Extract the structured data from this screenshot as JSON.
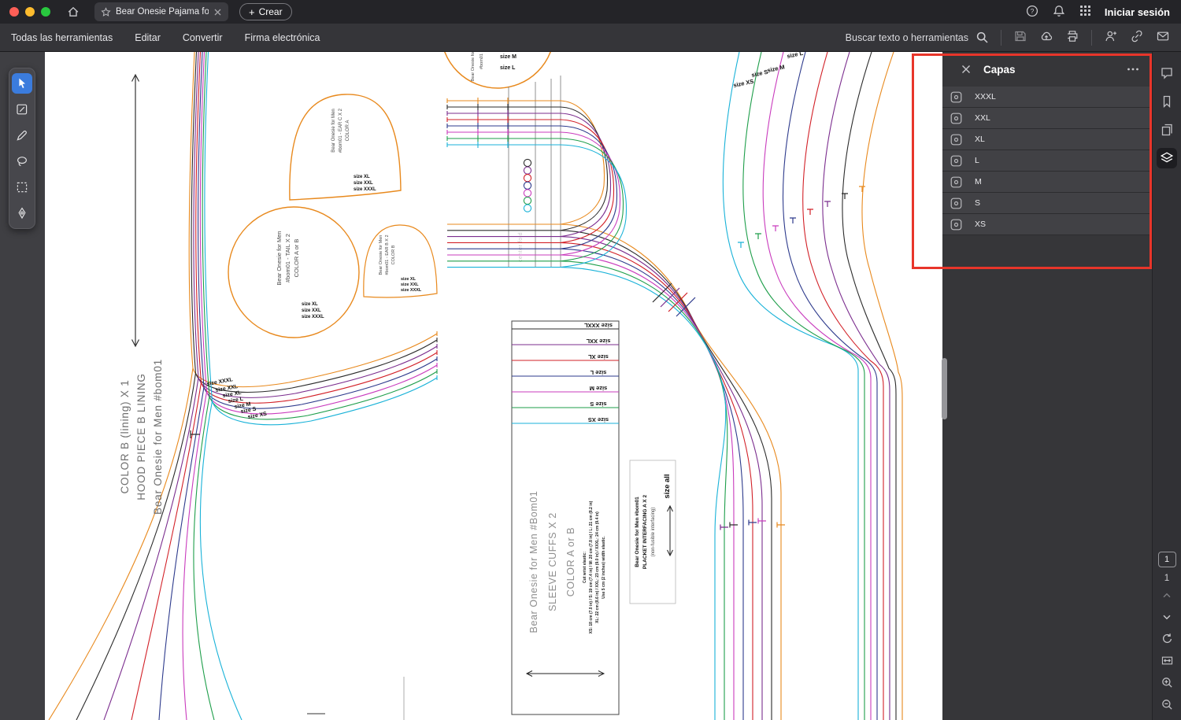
{
  "window": {
    "tab_title": "Bear Onesie Pajama fo...",
    "create_label": "Crear",
    "sign_in_label": "Iniciar sesión"
  },
  "menubar": {
    "items": [
      "Todas las herramientas",
      "Editar",
      "Convertir",
      "Firma electrónica"
    ],
    "search_label": "Buscar texto o herramientas"
  },
  "layers_panel": {
    "title": "Capas",
    "layers": [
      {
        "label": "XXXL"
      },
      {
        "label": "XXL"
      },
      {
        "label": "XL"
      },
      {
        "label": "L"
      },
      {
        "label": "M"
      },
      {
        "label": "S"
      },
      {
        "label": "XS"
      }
    ]
  },
  "right_rail": {
    "current_page": "1",
    "total_pages": "1"
  },
  "pattern": {
    "hood": {
      "line1": "Bear Onesie for Men #bom01",
      "line2": "HOOD PIECE B LINING",
      "line3": "COLOR B (lining) X 1",
      "sizes": [
        "size XXXL",
        "size XXL",
        "size XL",
        "size L",
        "size M",
        "size S",
        "size XS"
      ]
    },
    "ear_c": {
      "line1": "Bear Onesie for Men",
      "line2": "#bom01 - EAR C X 2",
      "line3": "COLOR A",
      "size1": "size XL",
      "size2": "size XXL",
      "size3": "size XXXL"
    },
    "tail": {
      "line1": "Bear Onesie for Men",
      "line2": "#bom01 - TAIL X 2",
      "line3": "COLOR A or B",
      "size1": "size XL",
      "size2": "size XXL",
      "size3": "size XXXL"
    },
    "ear_b": {
      "line1": "Bear Onesie for Men",
      "line2": "#bom01 - EAR B X 2",
      "line3": "COLOR B",
      "size1": "size XL",
      "size2": "size XXL",
      "size3": "size XXXL"
    },
    "top_piece": {
      "line1": "Bear Onesie for Men",
      "line2": "#bom01",
      "size1": "size M",
      "size2": "size L"
    },
    "right_piece": {
      "size1": "size L",
      "size2": "size M",
      "size3": "size S",
      "size4": "size XS"
    },
    "cuffs": {
      "line1": "Bear Onesie for Men #Bom01",
      "line2": "SLEEVE CUFFS X 2",
      "line3": "COLOR A or B",
      "elastic1": "Cut wrist elastic:",
      "elastic2": "XS: 18 cm (7.0 in) / S: 19 cm (7.4 in) / M: 20 cm (7.8 in) / L: 21 cm (8.2 in)",
      "elastic3": "XL: 22 cm (8.6 in) / XXL: 23 cm (9.0 in) / XXXL: 24 cm (9.4 in)",
      "elastic4": "Use 5 cm (2 inches) width elastic.",
      "sizes": [
        "size XXXL",
        "size XXL",
        "size XL",
        "size L",
        "size M",
        "size S",
        "size XS"
      ]
    },
    "placket": {
      "line1": "Bear Onesie for Men #bom01",
      "line2": "PLACKET INTERFACING A X 2",
      "line3": "(non-fusible interfacing)",
      "size_all": "size all"
    },
    "center_fold": "center fold"
  },
  "colors": {
    "accent_blue": "#3b7cdd",
    "highlight_red": "#e8352a",
    "outline_orange": "#e8891d",
    "size_colors": {
      "XXXL": "#2b2b2b",
      "XXL": "#7b2d8e",
      "XL": "#d22027",
      "L": "#2d3a8c",
      "M": "#c93bbd",
      "S": "#1e9e4a",
      "XS": "#19b2d8"
    }
  }
}
